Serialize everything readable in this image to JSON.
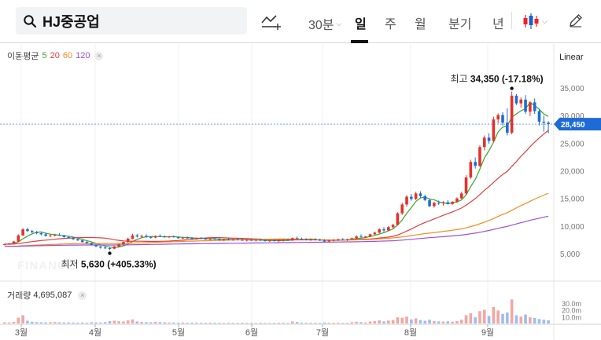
{
  "search": {
    "value": "HJ중공업"
  },
  "toolbar": {
    "interval": "30분",
    "periods": [
      "일",
      "주",
      "월",
      "분기",
      "년"
    ],
    "active_period": "일"
  },
  "ma": {
    "label": "이동평균",
    "lines": [
      {
        "value": "5",
        "color": "#3aa52f"
      },
      {
        "value": "20",
        "color": "#e03c3c"
      },
      {
        "value": "60",
        "color": "#f08c1e"
      },
      {
        "value": "120",
        "color": "#9b4fd6"
      }
    ]
  },
  "scale": "Linear",
  "volume": {
    "label": "거래량",
    "value": "4,695,087"
  },
  "watermark": "FINANCE",
  "chart_data": {
    "type": "candlestick",
    "y_axis": {
      "ticks": [
        "5,000",
        "10,000",
        "15,000",
        "20,000",
        "25,000",
        "30,000",
        "35,000"
      ]
    },
    "x_axis": {
      "ticks": [
        "3월",
        "4월",
        "5월",
        "6월",
        "7월",
        "8월",
        "9월"
      ]
    },
    "current_price": "28,450",
    "high_annotation": {
      "label": "최고",
      "value": "34,350",
      "change": "(-17.18%)"
    },
    "low_annotation": {
      "label": "최저",
      "value": "5,630",
      "change": "(+405.33%)"
    },
    "volume_ticks": [
      "30.0m",
      "20.0m",
      "10.0m"
    ],
    "candles": [
      [
        6600,
        6800,
        6500,
        6700
      ],
      [
        6700,
        6900,
        6600,
        6850
      ],
      [
        6850,
        7300,
        6800,
        7200
      ],
      [
        7200,
        8500,
        7100,
        8300
      ],
      [
        8300,
        9600,
        8200,
        9400
      ],
      [
        9400,
        9700,
        8900,
        9100
      ],
      [
        9100,
        9300,
        8700,
        8900
      ],
      [
        8900,
        9100,
        8500,
        8700
      ],
      [
        8700,
        8900,
        8300,
        8500
      ],
      [
        8500,
        8800,
        8100,
        8200
      ],
      [
        8200,
        8500,
        8000,
        8300
      ],
      [
        8300,
        8600,
        8100,
        8400
      ],
      [
        8400,
        8700,
        8200,
        8300
      ],
      [
        8300,
        8400,
        7900,
        8000
      ],
      [
        8000,
        8200,
        7700,
        7800
      ],
      [
        7800,
        8000,
        7500,
        7600
      ],
      [
        7600,
        7800,
        7300,
        7400
      ],
      [
        7400,
        7500,
        7000,
        7100
      ],
      [
        7100,
        7300,
        6800,
        6900
      ],
      [
        6900,
        7000,
        6500,
        6600
      ],
      [
        6600,
        6700,
        6200,
        6300
      ],
      [
        6300,
        6400,
        5900,
        6100
      ],
      [
        6100,
        6300,
        5800,
        6000
      ],
      [
        6000,
        6200,
        5630,
        5900
      ],
      [
        5900,
        6400,
        5800,
        6300
      ],
      [
        6300,
        6800,
        6200,
        6700
      ],
      [
        6700,
        7200,
        6600,
        7100
      ],
      [
        7100,
        7900,
        7000,
        7700
      ],
      [
        7700,
        8600,
        7600,
        8300
      ],
      [
        8300,
        8600,
        7900,
        8100
      ],
      [
        8100,
        8400,
        7800,
        8200
      ],
      [
        8200,
        8500,
        7900,
        8000
      ],
      [
        8000,
        8200,
        7700,
        7900
      ],
      [
        7900,
        8300,
        7800,
        8200
      ],
      [
        8200,
        8500,
        8000,
        8100
      ],
      [
        8100,
        8300,
        7900,
        8000
      ],
      [
        8000,
        8200,
        7800,
        8100
      ],
      [
        8100,
        8300,
        7900,
        8000
      ],
      [
        8000,
        8100,
        7700,
        7800
      ],
      [
        7800,
        8000,
        7600,
        7900
      ],
      [
        7900,
        8100,
        7700,
        7800
      ],
      [
        7800,
        8000,
        7600,
        7700
      ],
      [
        7700,
        7900,
        7500,
        7800
      ],
      [
        7800,
        8000,
        7600,
        7700
      ],
      [
        7700,
        7900,
        7500,
        7600
      ],
      [
        7600,
        7800,
        7400,
        7700
      ],
      [
        7700,
        7900,
        7500,
        7600
      ],
      [
        7600,
        7800,
        7400,
        7500
      ],
      [
        7500,
        7700,
        7300,
        7600
      ],
      [
        7600,
        7800,
        7400,
        7500
      ],
      [
        7500,
        7700,
        7300,
        7600
      ],
      [
        7600,
        7800,
        7400,
        7500
      ],
      [
        7500,
        7700,
        7300,
        7400
      ],
      [
        7400,
        7600,
        7200,
        7500
      ],
      [
        7500,
        7700,
        7300,
        7400
      ],
      [
        7400,
        7600,
        7200,
        7500
      ],
      [
        7500,
        7700,
        7300,
        7400
      ],
      [
        7400,
        7600,
        7200,
        7300
      ],
      [
        7300,
        7500,
        7100,
        7400
      ],
      [
        7400,
        7600,
        7200,
        7300
      ],
      [
        7300,
        7500,
        7100,
        7400
      ],
      [
        7400,
        7600,
        7200,
        7500
      ],
      [
        7500,
        7700,
        7300,
        7400
      ],
      [
        7400,
        7900,
        7300,
        7800
      ],
      [
        7800,
        8100,
        7600,
        7700
      ],
      [
        7700,
        7900,
        7500,
        7600
      ],
      [
        7600,
        7800,
        7400,
        7500
      ],
      [
        7500,
        7700,
        7300,
        7600
      ],
      [
        7600,
        7800,
        7400,
        7500
      ],
      [
        7500,
        7700,
        7300,
        7400
      ],
      [
        7400,
        7600,
        7100,
        7200
      ],
      [
        7200,
        7500,
        7000,
        7400
      ],
      [
        7400,
        7600,
        7200,
        7500
      ],
      [
        7500,
        7700,
        7300,
        7600
      ],
      [
        7600,
        7800,
        7400,
        7500
      ],
      [
        7500,
        7700,
        7300,
        7600
      ],
      [
        7600,
        7900,
        7500,
        7800
      ],
      [
        7800,
        8300,
        7700,
        8100
      ],
      [
        8100,
        8500,
        7900,
        8000
      ],
      [
        8000,
        8200,
        7800,
        8100
      ],
      [
        8100,
        8600,
        8000,
        8500
      ],
      [
        8500,
        9000,
        8400,
        8800
      ],
      [
        8800,
        9600,
        8700,
        9400
      ],
      [
        9400,
        9800,
        8900,
        9200
      ],
      [
        9200,
        10000,
        9100,
        9800
      ],
      [
        9800,
        10400,
        9500,
        10200
      ],
      [
        10200,
        12500,
        10100,
        12300
      ],
      [
        12300,
        14200,
        12000,
        13900
      ],
      [
        13900,
        15600,
        13500,
        15300
      ],
      [
        15300,
        15800,
        14600,
        14900
      ],
      [
        14900,
        16200,
        14700,
        15900
      ],
      [
        15900,
        16300,
        15100,
        15400
      ],
      [
        15400,
        15700,
        14500,
        14700
      ],
      [
        14700,
        14900,
        13400,
        13600
      ],
      [
        13600,
        14400,
        13300,
        14200
      ],
      [
        14200,
        14600,
        13800,
        14100
      ],
      [
        14100,
        14500,
        13700,
        14300
      ],
      [
        14300,
        14700,
        13900,
        14000
      ],
      [
        14000,
        14500,
        13800,
        14400
      ],
      [
        14400,
        15200,
        14200,
        15000
      ],
      [
        15000,
        16200,
        14900,
        15900
      ],
      [
        15900,
        19200,
        15700,
        18800
      ],
      [
        18800,
        22000,
        18500,
        21600
      ],
      [
        21600,
        22400,
        20400,
        20900
      ],
      [
        20900,
        24600,
        20700,
        24300
      ],
      [
        24300,
        26400,
        23700,
        26000
      ],
      [
        26000,
        26800,
        24900,
        25400
      ],
      [
        25400,
        29800,
        25200,
        29300
      ],
      [
        29300,
        30400,
        28600,
        30100
      ],
      [
        30100,
        30600,
        28200,
        28700
      ],
      [
        28700,
        31300,
        26400,
        26900
      ],
      [
        26900,
        34350,
        26600,
        33600
      ],
      [
        33600,
        33900,
        31900,
        32200
      ],
      [
        32200,
        33300,
        31400,
        32900
      ],
      [
        32900,
        33700,
        30300,
        30700
      ],
      [
        30700,
        32600,
        29900,
        32400
      ],
      [
        32400,
        33100,
        30300,
        30800
      ],
      [
        30800,
        31100,
        28200,
        28900
      ],
      [
        28900,
        30000,
        27100,
        28700
      ],
      [
        28700,
        29000,
        26800,
        28450
      ]
    ],
    "volumes": [
      1.8,
      1.5,
      2.2,
      8.5,
      12.0,
      4.0,
      2.5,
      2.0,
      1.8,
      1.6,
      1.9,
      2.1,
      1.7,
      1.5,
      1.6,
      1.4,
      1.3,
      1.5,
      1.2,
      1.8,
      1.6,
      1.4,
      2.0,
      3.5,
      4.0,
      3.2,
      2.8,
      4.5,
      6.0,
      3.0,
      2.2,
      1.9,
      1.7,
      2.4,
      2.0,
      1.6,
      1.4,
      1.5,
      1.3,
      1.5,
      1.2,
      1.4,
      1.3,
      1.2,
      1.1,
      1.3,
      1.2,
      1.1,
      1.0,
      1.2,
      1.1,
      1.0,
      1.2,
      1.1,
      1.0,
      0.9,
      1.1,
      1.0,
      0.9,
      1.0,
      1.1,
      1.2,
      1.0,
      3.0,
      2.2,
      1.4,
      1.2,
      1.1,
      1.0,
      0.9,
      1.5,
      1.2,
      1.1,
      1.3,
      1.0,
      1.1,
      1.8,
      2.5,
      2.0,
      1.6,
      2.8,
      3.5,
      4.5,
      3.0,
      4.2,
      5.0,
      9.0,
      8.5,
      10.0,
      6.0,
      7.5,
      5.0,
      4.0,
      5.5,
      3.5,
      3.0,
      2.8,
      3.2,
      2.6,
      3.5,
      5.5,
      12.0,
      15.0,
      9.0,
      18.0,
      20.0,
      11.0,
      24.0,
      19.0,
      14.0,
      16.0,
      35.0,
      12.0,
      10.0,
      13.0,
      9.0,
      8.0,
      6.5,
      5.5,
      4.7
    ]
  }
}
